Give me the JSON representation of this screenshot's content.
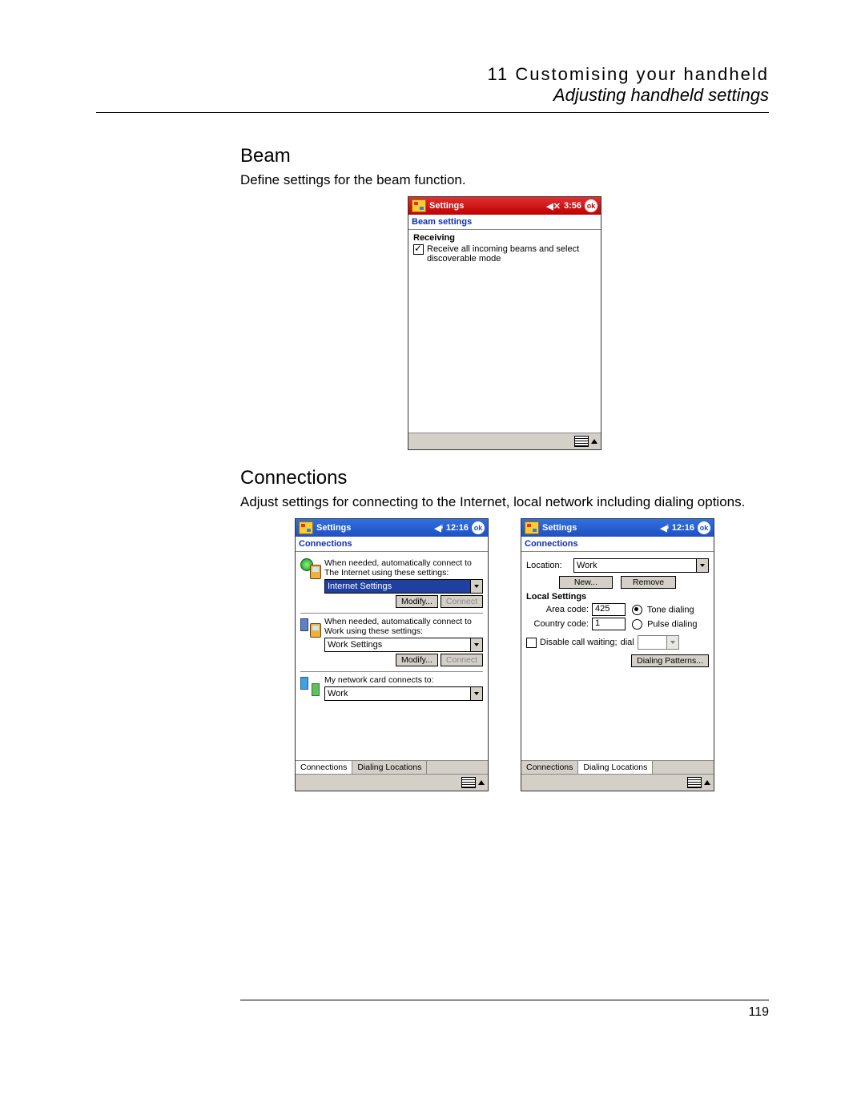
{
  "header": {
    "chapter": "11 Customising your handheld",
    "subhead": "Adjusting handheld settings"
  },
  "beam": {
    "title": "Beam",
    "desc": "Define settings for the beam function.",
    "shot": {
      "titlebar": "Settings",
      "time": "3:56",
      "ok": "ok",
      "subhead": "Beam settings",
      "section_label": "Receiving",
      "checkbox_label": "Receive all incoming beams and select discoverable mode"
    }
  },
  "conn": {
    "title": "Connections",
    "desc": "Adjust settings for connecting to the Internet, local network including dialing options.",
    "left": {
      "titlebar": "Settings",
      "time": "12:16",
      "ok": "ok",
      "subhead": "Connections",
      "internet_text": "When needed, automatically connect to The Internet using these settings:",
      "internet_dd": "Internet Settings",
      "modify": "Modify...",
      "connect": "Connect",
      "work_text": "When needed, automatically connect to Work using these settings:",
      "work_dd": "Work Settings",
      "netcard_text": "My network card connects to:",
      "netcard_dd": "Work",
      "tab1": "Connections",
      "tab2": "Dialing Locations"
    },
    "right": {
      "titlebar": "Settings",
      "time": "12:16",
      "ok": "ok",
      "subhead": "Connections",
      "location_lbl": "Location:",
      "location_val": "Work",
      "new_btn": "New...",
      "remove_btn": "Remove",
      "local_settings": "Local Settings",
      "area_code_lbl": "Area code:",
      "area_code_val": "425",
      "country_code_lbl": "Country code:",
      "country_code_val": "1",
      "tone": "Tone dialing",
      "pulse": "Pulse dialing",
      "disable_cw": "Disable call waiting;",
      "dial_lbl": "dial",
      "dialing_patterns": "Dialing Patterns...",
      "tab1": "Connections",
      "tab2": "Dialing Locations"
    }
  },
  "page_number": "119"
}
